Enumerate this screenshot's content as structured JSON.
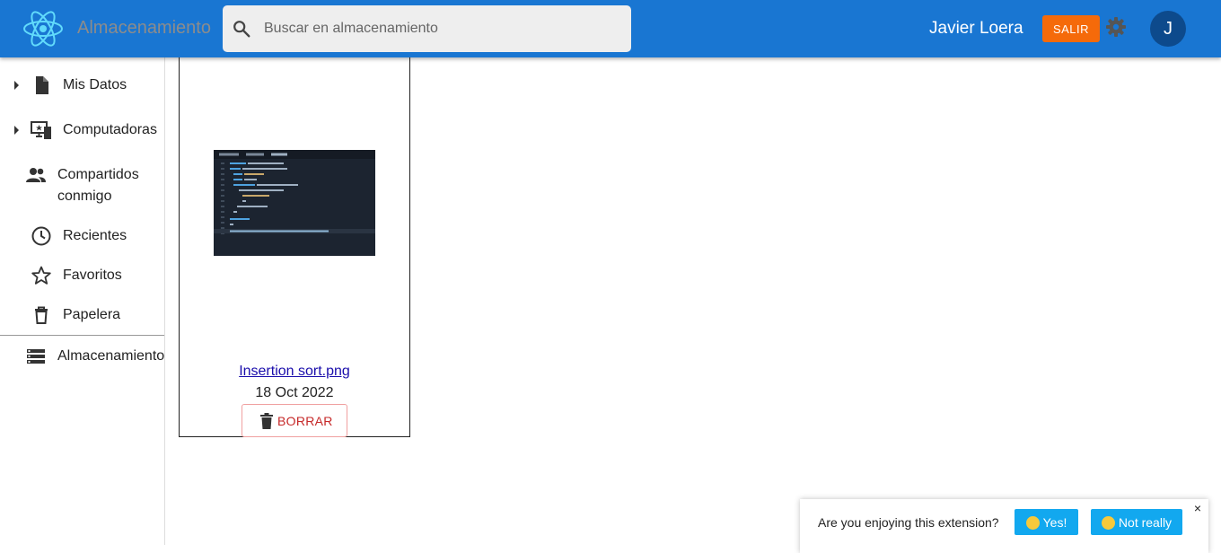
{
  "header": {
    "app_title": "Almacenamiento",
    "search_placeholder": "Buscar en almacenamiento",
    "user_name": "Javier Loera",
    "logout_label": "SALIR",
    "avatar_initial": "J",
    "colors": {
      "bar": "#1976d2",
      "logout": "#f56a0a",
      "avatar": "#0d4a8c",
      "logo": "#61dafb"
    }
  },
  "sidebar": {
    "items": [
      {
        "label": "Mis Datos",
        "icon": "file-icon",
        "expandable": true
      },
      {
        "label": "Computadoras",
        "icon": "computer-icon",
        "expandable": true
      },
      {
        "label": "Compartidos conmigo",
        "icon": "people-icon",
        "expandable": false
      },
      {
        "label": "Recientes",
        "icon": "clock-icon",
        "expandable": false
      },
      {
        "label": "Favoritos",
        "icon": "star-icon",
        "expandable": false
      },
      {
        "label": "Papelera",
        "icon": "trash-icon",
        "expandable": false
      }
    ],
    "storage_label": "Almacenamiento"
  },
  "file_card": {
    "file_name": "Insertion sort.png",
    "date": "18 Oct 2022",
    "delete_label": "BORRAR"
  },
  "feedback": {
    "question": "Are you enjoying this extension?",
    "yes_label": "Yes!",
    "no_label": "Not really",
    "close_glyph": "×",
    "button_color": "#12a8ef"
  }
}
